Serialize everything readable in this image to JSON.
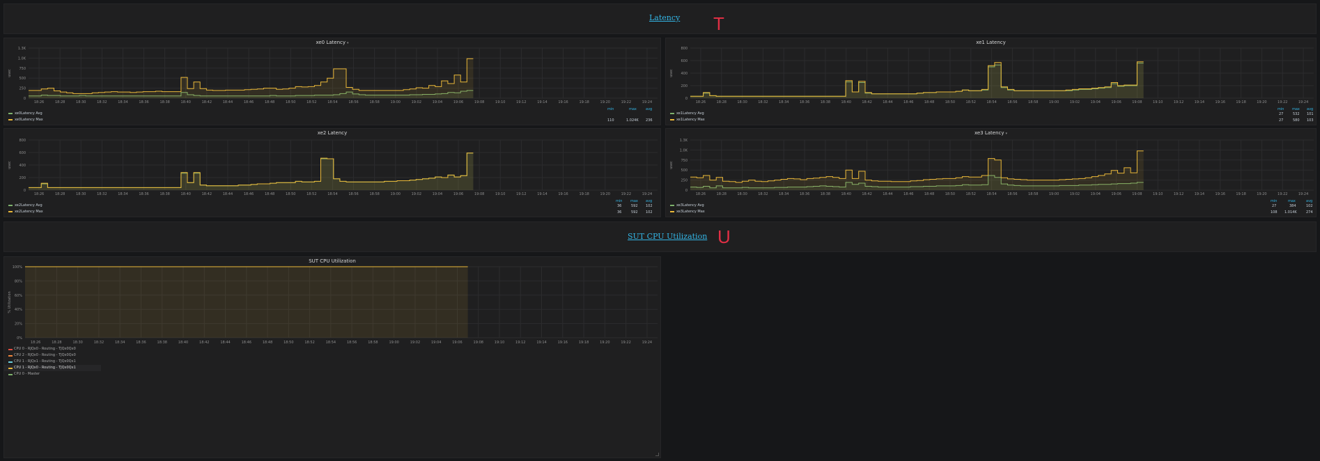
{
  "rows": [
    {
      "title": "Latency",
      "marker": "T"
    },
    {
      "title": "SUT CPU Utilization",
      "marker": "U"
    }
  ],
  "time_ticks": [
    "18:26",
    "18:28",
    "18:30",
    "18:32",
    "18:34",
    "18:36",
    "18:38",
    "18:40",
    "18:42",
    "18:44",
    "18:46",
    "18:48",
    "18:50",
    "18:52",
    "18:54",
    "18:56",
    "18:58",
    "19:00",
    "19:02",
    "19:04",
    "19:06",
    "19:08",
    "19:10",
    "19:12",
    "19:14",
    "19:16",
    "19:18",
    "19:20",
    "19:22",
    "19:24"
  ],
  "legend_headers": {
    "min": "min",
    "max": "max",
    "avg": "avg"
  },
  "colors": {
    "avg": "#7eb26d",
    "max": "#eab839",
    "cpu0": "#e24d42",
    "cpu2": "#ef843c",
    "cpu1": "#6ed0e0",
    "cpu3": "#eab839",
    "master": "#7eb26d"
  },
  "panels": [
    {
      "title": "xe0 Latency",
      "has_caret": true,
      "caret": "▾",
      "ylabel": "usec",
      "yticks": [
        "1.3K",
        "1.0K",
        "750",
        "500",
        "250",
        "0"
      ],
      "legend": [
        {
          "name": "xe0Latency Avg",
          "min": "",
          "max": "",
          "avg": ""
        },
        {
          "name": "xe0Latency Max",
          "min": "110",
          "max": "1.024K",
          "avg": "236"
        }
      ],
      "chart_data": {
        "type": "area",
        "ylim": [
          0,
          1300
        ],
        "series": [
          {
            "name": "xe0Latency Avg",
            "values": [
              60,
              60,
              80,
              70,
              70,
              60,
              60,
              60,
              70,
              60,
              60,
              60,
              60,
              60,
              60,
              60,
              60,
              60,
              60,
              60,
              60,
              60,
              60,
              60,
              150,
              90,
              70,
              60,
              60,
              60,
              60,
              60,
              60,
              60,
              60,
              60,
              60,
              60,
              70,
              60,
              60,
              60,
              70,
              70,
              70,
              80,
              80,
              80,
              90,
              120,
              160,
              110,
              90,
              80,
              80,
              80,
              80,
              80,
              80,
              80,
              90,
              90,
              100,
              100,
              110,
              120,
              150,
              140,
              180,
              200
            ]
          },
          {
            "name": "xe0Latency Max",
            "values": [
              200,
              200,
              240,
              260,
              190,
              160,
              140,
              120,
              120,
              120,
              140,
              150,
              160,
              170,
              160,
              160,
              150,
              160,
              170,
              170,
              180,
              170,
              170,
              170,
              540,
              250,
              420,
              250,
              210,
              200,
              200,
              210,
              210,
              210,
              220,
              230,
              240,
              260,
              260,
              230,
              240,
              260,
              300,
              290,
              300,
              330,
              420,
              520,
              760,
              760,
              280,
              230,
              200,
              200,
              200,
              200,
              200,
              200,
              200,
              220,
              240,
              270,
              260,
              330,
              300,
              450,
              380,
              600,
              420,
              1024
            ]
          }
        ]
      }
    },
    {
      "title": "xe1 Latency",
      "has_caret": false,
      "ylabel": "usec",
      "yticks": [
        "800",
        "600",
        "400",
        "200",
        "0"
      ],
      "legend": [
        {
          "name": "xe1Latency Avg",
          "min": "27",
          "max": "532",
          "avg": "101"
        },
        {
          "name": "xe1Latency Max",
          "min": "27",
          "max": "580",
          "avg": "103"
        }
      ],
      "chart_data": {
        "type": "area",
        "ylim": [
          0,
          800
        ],
        "series": [
          {
            "name": "xe1Latency Avg",
            "values": [
              30,
              30,
              80,
              40,
              30,
              30,
              30,
              30,
              30,
              30,
              30,
              30,
              30,
              30,
              30,
              30,
              30,
              30,
              30,
              30,
              30,
              30,
              30,
              30,
              260,
              100,
              250,
              80,
              70,
              70,
              70,
              70,
              70,
              70,
              70,
              80,
              90,
              90,
              100,
              100,
              100,
              110,
              130,
              120,
              120,
              130,
              500,
              530,
              170,
              130,
              120,
              120,
              120,
              120,
              120,
              120,
              120,
              120,
              120,
              130,
              140,
              140,
              150,
              160,
              170,
              230,
              190,
              200,
              200,
              560
            ]
          },
          {
            "name": "xe1Latency Max",
            "values": [
              30,
              30,
              90,
              40,
              30,
              30,
              30,
              30,
              30,
              30,
              30,
              30,
              30,
              30,
              30,
              30,
              30,
              30,
              30,
              30,
              30,
              30,
              30,
              30,
              280,
              100,
              270,
              90,
              70,
              70,
              70,
              70,
              70,
              70,
              70,
              80,
              90,
              90,
              100,
              100,
              100,
              110,
              130,
              120,
              120,
              140,
              520,
              570,
              180,
              140,
              120,
              120,
              120,
              120,
              120,
              120,
              120,
              120,
              130,
              140,
              150,
              150,
              160,
              170,
              180,
              250,
              200,
              210,
              210,
              580
            ]
          }
        ]
      }
    },
    {
      "title": "xe2 Latency",
      "has_caret": false,
      "ylabel": "usec",
      "yticks": [
        "800",
        "600",
        "400",
        "200",
        "0"
      ],
      "legend": [
        {
          "name": "xe2Latency Avg",
          "min": "36",
          "max": "592",
          "avg": "102"
        },
        {
          "name": "xe2Latency Max",
          "min": "36",
          "max": "592",
          "avg": "102"
        }
      ],
      "chart_data": {
        "type": "area",
        "ylim": [
          0,
          800
        ],
        "series": [
          {
            "name": "xe2Latency Avg",
            "values": [
              40,
              40,
              100,
              40,
              40,
              40,
              40,
              40,
              40,
              40,
              40,
              40,
              40,
              40,
              40,
              40,
              40,
              40,
              40,
              40,
              40,
              40,
              40,
              40,
              270,
              120,
              270,
              80,
              70,
              70,
              70,
              70,
              70,
              80,
              80,
              90,
              100,
              100,
              110,
              120,
              120,
              120,
              140,
              130,
              130,
              140,
              500,
              500,
              180,
              140,
              130,
              130,
              130,
              130,
              130,
              130,
              140,
              140,
              150,
              150,
              160,
              170,
              180,
              190,
              210,
              200,
              240,
              210,
              230,
              590
            ]
          },
          {
            "name": "xe2Latency Max",
            "values": [
              40,
              40,
              110,
              40,
              40,
              40,
              40,
              40,
              40,
              40,
              40,
              40,
              40,
              40,
              40,
              40,
              40,
              40,
              40,
              40,
              40,
              40,
              40,
              40,
              280,
              120,
              280,
              80,
              70,
              70,
              70,
              70,
              70,
              80,
              80,
              90,
              100,
              100,
              110,
              120,
              120,
              120,
              140,
              130,
              130,
              140,
              510,
              500,
              180,
              140,
              130,
              130,
              130,
              130,
              130,
              130,
              140,
              140,
              150,
              150,
              160,
              170,
              180,
              190,
              210,
              200,
              240,
              210,
              230,
              592
            ]
          }
        ]
      }
    },
    {
      "title": "xe3 Latency",
      "has_caret": true,
      "caret": "▾",
      "ylabel": "usec",
      "yticks": [
        "1.3K",
        "1.0K",
        "750",
        "500",
        "250",
        "0"
      ],
      "legend": [
        {
          "name": "xe3Latency Avg",
          "min": "27",
          "max": "384",
          "avg": "102"
        },
        {
          "name": "xe3Latency Max",
          "min": "108",
          "max": "1.014K",
          "avg": "274"
        }
      ],
      "chart_data": {
        "type": "area",
        "ylim": [
          0,
          1300
        ],
        "series": [
          {
            "name": "xe3Latency Avg",
            "values": [
              80,
              70,
              100,
              60,
              110,
              60,
              60,
              60,
              70,
              60,
              60,
              60,
              60,
              70,
              70,
              80,
              80,
              80,
              90,
              100,
              110,
              100,
              90,
              80,
              200,
              150,
              180,
              100,
              90,
              80,
              80,
              80,
              80,
              80,
              90,
              90,
              100,
              100,
              110,
              110,
              110,
              120,
              140,
              130,
              130,
              140,
              380,
              330,
              160,
              130,
              120,
              110,
              110,
              110,
              110,
              110,
              110,
              120,
              120,
              120,
              130,
              130,
              140,
              150,
              150,
              160,
              170,
              170,
              180,
              200
            ]
          },
          {
            "name": "xe3Latency Max",
            "values": [
              340,
              320,
              380,
              260,
              330,
              230,
              220,
              200,
              230,
              260,
              230,
              220,
              240,
              260,
              280,
              300,
              290,
              270,
              300,
              310,
              330,
              350,
              330,
              300,
              520,
              300,
              490,
              260,
              240,
              230,
              230,
              220,
              220,
              220,
              240,
              250,
              270,
              280,
              290,
              300,
              300,
              320,
              350,
              340,
              340,
              380,
              820,
              780,
              320,
              290,
              280,
              270,
              260,
              260,
              260,
              260,
              260,
              270,
              280,
              290,
              300,
              320,
              350,
              380,
              420,
              510,
              440,
              580,
              450,
              1014
            ]
          }
        ]
      }
    },
    {
      "title": "SUT CPU Utilization",
      "has_caret": false,
      "ylabel": "% Utilization",
      "yticks": [
        "100%",
        "80%",
        "60%",
        "40%",
        "20%",
        "0%"
      ],
      "legend": [
        {
          "name": "CPU 0 - RJQx0 - Routing - TJQx0Qx0"
        },
        {
          "name": "CPU 2 - RJQx0 - Routing - TJQx0Qx0"
        },
        {
          "name": "CPU 1 - RJQx1 - Routing - TJQx0Qx1"
        },
        {
          "name": "CPU 1 - RJQx0 - Routing - TJQx0Qx1"
        },
        {
          "name": "CPU 0 - Master"
        }
      ],
      "chart_data": {
        "type": "area",
        "ylim": [
          0,
          100
        ],
        "series": [
          {
            "name": "CPU 1 - RJQx0 - Routing - TJQx0Qx1",
            "values": [
              100,
              100,
              100,
              100,
              100,
              100,
              100,
              100,
              100,
              100,
              100,
              100,
              100,
              100,
              100,
              100,
              100,
              100,
              100,
              100,
              100,
              100,
              100,
              100,
              100,
              100,
              100,
              100,
              100,
              100,
              100,
              100,
              100,
              100,
              100,
              100,
              100,
              100,
              100,
              100,
              100,
              100,
              100,
              100,
              100,
              100,
              100,
              100,
              100,
              100,
              100,
              100,
              100,
              100,
              100,
              100,
              100,
              100,
              100,
              100,
              100,
              100,
              100,
              100,
              100,
              100,
              100,
              100,
              100,
              100
            ]
          }
        ]
      }
    }
  ]
}
